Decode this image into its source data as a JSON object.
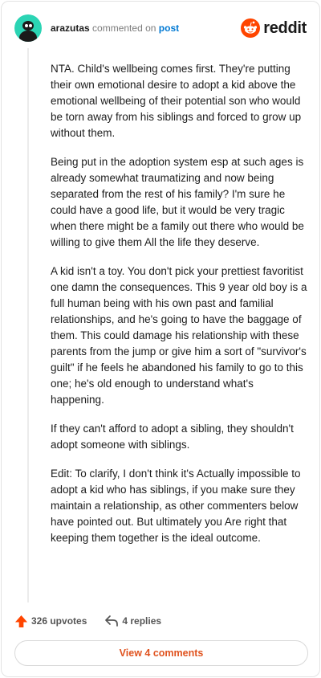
{
  "header": {
    "username": "arazutas",
    "action_text": "commented on",
    "post_link": "post",
    "brand": "reddit"
  },
  "comment": {
    "paragraphs": [
      "NTA. Child's wellbeing comes first. They're putting their own emotional desire to adopt a kid above the emotional wellbeing of their potential son who would be torn away from his siblings and forced to grow up without them.",
      "Being put in the adoption system esp at such ages is already somewhat traumatizing and now being separated from the rest of his family? I'm sure he could have a good life, but it would be very tragic when there might be a family out there who would be willing to give them All the life they deserve.",
      "A kid isn't a toy. You don't pick your prettiest favoritist one damn the consequences. This 9 year old boy is a full human being with his own past and familial relationships, and he's going to have the baggage of them. This could damage his relationship with these parents from the jump or give him a sort of \"survivor's guilt\" if he feels he abandoned his family to go to this one; he's old enough to understand what's happening.",
      "If they can't afford to adopt a sibling, they shouldn't adopt someone with siblings.",
      "Edit: To clarify, I don't think it's Actually impossible to adopt a kid who has siblings, if you make sure they maintain a relationship, as other commenters below have pointed out. But ultimately you Are right that keeping them together is the ideal outcome."
    ]
  },
  "actions": {
    "upvotes": "326 upvotes",
    "replies": "4 replies"
  },
  "footer": {
    "view_comments": "View 4 comments"
  },
  "colors": {
    "accent": "#ff4500",
    "link": "#0079d3",
    "avatar_bg": "#2bd4b4"
  },
  "icons": {
    "upvote": "upvote-arrow-icon",
    "reply": "reply-arrow-icon",
    "brand": "reddit-logo-icon"
  }
}
